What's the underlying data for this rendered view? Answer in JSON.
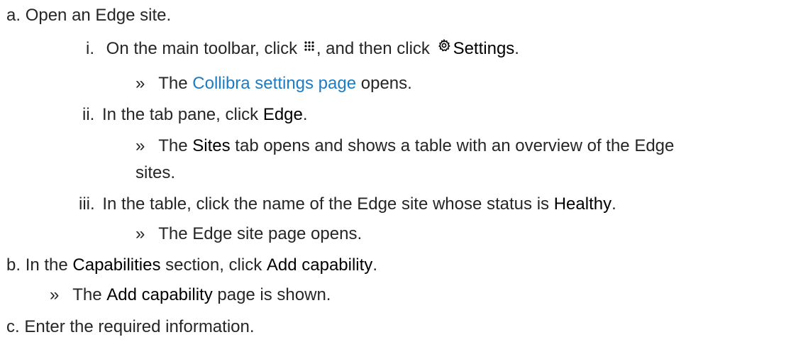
{
  "steps": {
    "a": {
      "marker": "a.",
      "text": "Open an Edge site.",
      "sub_i": {
        "marker": "i.",
        "text_1": "On the main toolbar, click",
        "text_2": ", and then click",
        "settings_label": "Settings",
        "text_3": ".",
        "result_mark": "»",
        "result_text_1": "The",
        "result_link": "Collibra settings page",
        "result_text_2": "opens."
      },
      "sub_ii": {
        "marker": "ii.",
        "text_1": "In the tab pane, click",
        "edge_label": "Edge",
        "text_2": ".",
        "result_mark": "»",
        "result_text_1": "The",
        "sites_label": "Sites",
        "result_text_2": "tab opens and shows a table with an overview of the Edge",
        "result_text_3": "sites."
      },
      "sub_iii": {
        "marker": "iii.",
        "text_1": "In the table, click the name of the Edge site whose status is",
        "healthy_label": "Healthy",
        "text_2": ".",
        "result_mark": "»",
        "result_text": "The Edge site page opens."
      }
    },
    "b": {
      "marker": "b.",
      "text_1": "In the",
      "capabilities_label": "Capabilities",
      "text_2": "section, click",
      "add_capability_label": "Add capability",
      "text_3": ".",
      "result_mark": "»",
      "result_text_1": "The",
      "result_add_capability": "Add capability",
      "result_text_2": "page is shown."
    },
    "c": {
      "marker": "c.",
      "text": "Enter the required information."
    }
  },
  "icons": {
    "apps": "apps-grid-icon",
    "settings": "gear-icon"
  },
  "colors": {
    "text": "#262626",
    "emphasis": "#000000",
    "link": "#1c7cc4"
  }
}
